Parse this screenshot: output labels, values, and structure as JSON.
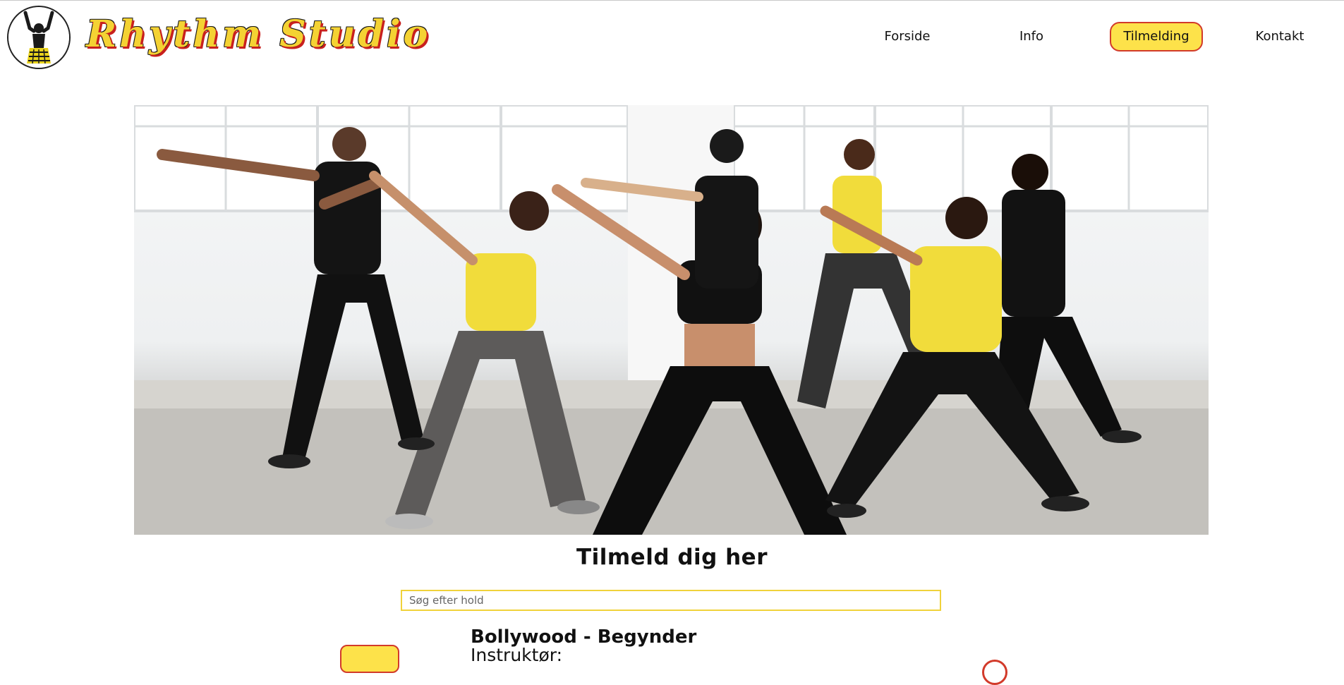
{
  "brand": {
    "name": "Rhythm Studio"
  },
  "nav": {
    "items": [
      {
        "label": "Forside",
        "active": false
      },
      {
        "label": "Info",
        "active": false
      },
      {
        "label": "Tilmelding",
        "active": true
      },
      {
        "label": "Kontakt",
        "active": false
      }
    ]
  },
  "colors": {
    "accent": "#fde24a",
    "accent_border": "#d23a2a",
    "text": "#111111"
  },
  "main": {
    "title": "Tilmeld dig her",
    "search": {
      "placeholder": "Søg efter hold",
      "value": ""
    },
    "classes": [
      {
        "name": "Bollywood - Begynder",
        "instructor_label": "Instruktør:"
      }
    ]
  },
  "icons": {
    "logo": "dancer-logo-icon"
  }
}
